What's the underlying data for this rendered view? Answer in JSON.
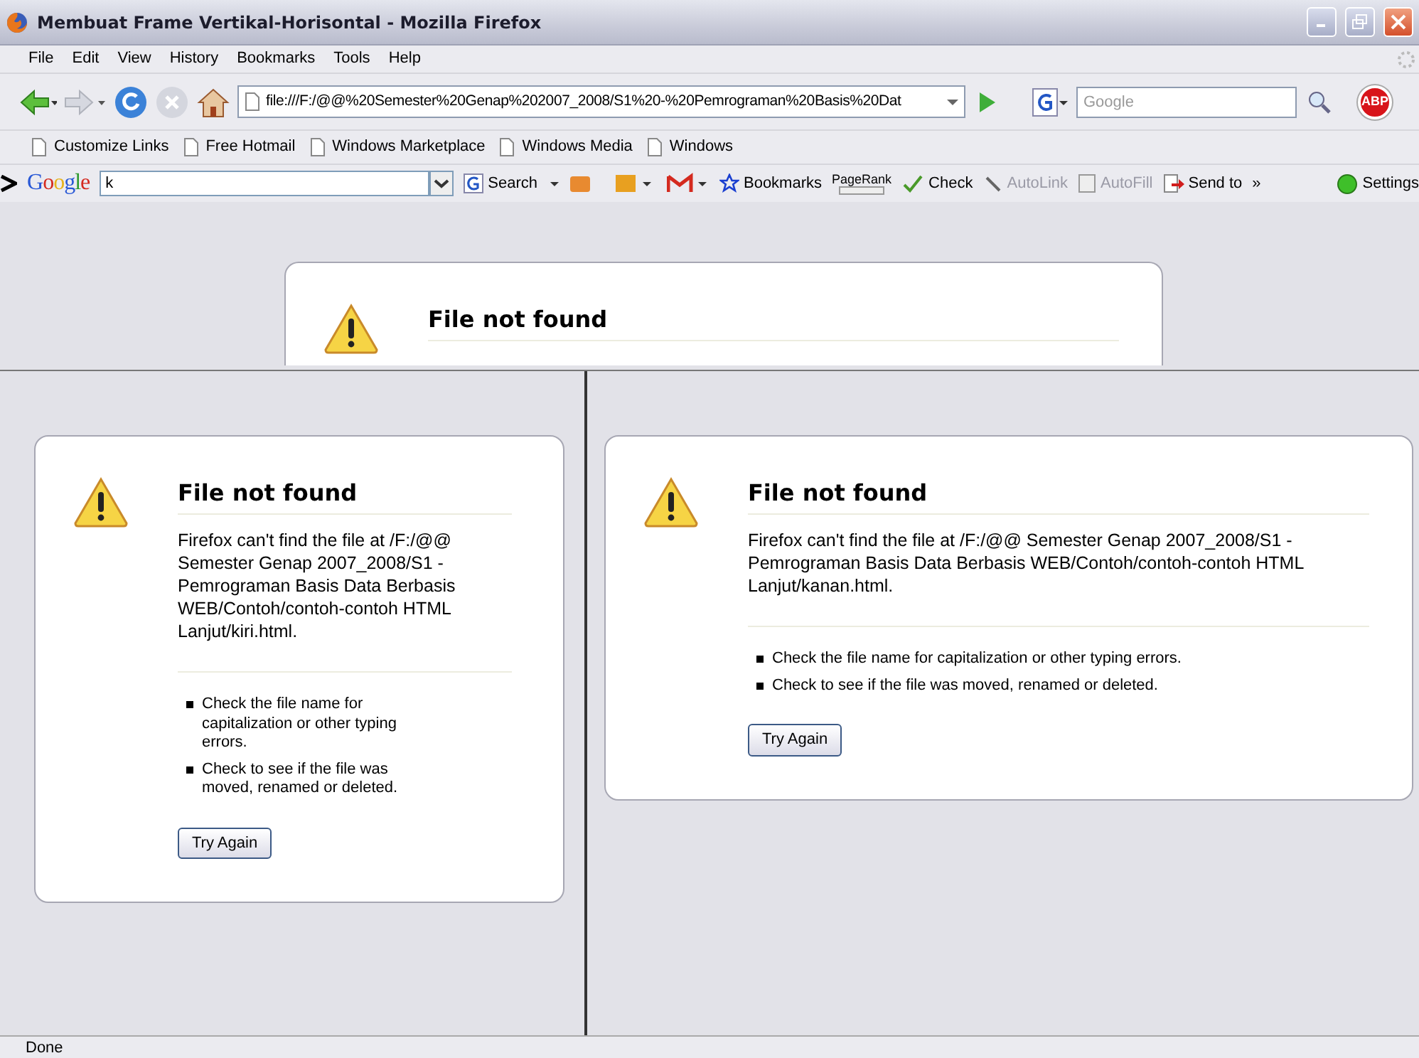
{
  "window": {
    "title": "Membuat Frame Vertikal-Horisontal - Mozilla Firefox"
  },
  "menu": [
    "File",
    "Edit",
    "View",
    "History",
    "Bookmarks",
    "Tools",
    "Help"
  ],
  "navigation": {
    "address": "file:///F:/@@%20Semester%20Genap%202007_2008/S1%20-%20Pemrograman%20Basis%20Dat",
    "search_placeholder": "Google",
    "adblock": "ABP"
  },
  "bookmarks": [
    "Customize Links",
    "Free Hotmail",
    "Windows Marketplace",
    "Windows Media",
    "Windows"
  ],
  "google_toolbar": {
    "logo": "Google",
    "query": "k",
    "items": [
      {
        "label": "Search",
        "kind": "search",
        "disabled": false
      },
      {
        "label": "Bookmarks",
        "kind": "star",
        "disabled": false
      },
      {
        "label": "PageRank",
        "kind": "rank",
        "disabled": false
      },
      {
        "label": "Check",
        "kind": "check",
        "disabled": false
      },
      {
        "label": "AutoLink",
        "kind": "wand",
        "disabled": true
      },
      {
        "label": "AutoFill",
        "kind": "form",
        "disabled": true
      },
      {
        "label": "Send to",
        "kind": "send",
        "disabled": false
      },
      {
        "label": "»",
        "kind": "more",
        "disabled": false
      },
      {
        "label": "Settings",
        "kind": "settings",
        "disabled": false
      }
    ]
  },
  "frames": {
    "top": {
      "heading": "File not found"
    },
    "left": {
      "heading": "File not found",
      "message": "Firefox can't find the file at /F:/@@ Semester Genap 2007_2008/S1 - Pemrograman Basis Data Berbasis WEB/Contoh/contoh-contoh HTML Lanjut/kiri.html.",
      "tips": [
        "Check the file name for capitalization or other typing errors.",
        "Check to see if the file was moved, renamed or deleted."
      ],
      "button": "Try Again"
    },
    "right": {
      "heading": "File not found",
      "message": "Firefox can't find the file at /F:/@@ Semester Genap 2007_2008/S1 - Pemrograman Basis Data Berbasis WEB/Contoh/contoh-contoh HTML Lanjut/kanan.html.",
      "tips": [
        "Check the file name for capitalization or other typing errors.",
        "Check to see if the file was moved, renamed or deleted."
      ],
      "button": "Try Again"
    }
  },
  "status_bar": "Done"
}
